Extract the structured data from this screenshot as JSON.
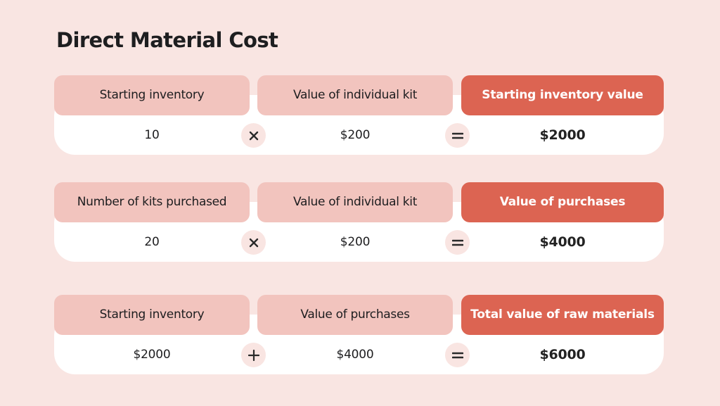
{
  "title": "Direct Material Cost",
  "colors": {
    "background": "#f9e5e2",
    "header_light": "#f2c4be",
    "header_accent": "#dc6452",
    "row": "#ffffff",
    "text": "#1d1d1f"
  },
  "equations": [
    {
      "operand_a": {
        "label": "Starting inventory",
        "value": "10"
      },
      "operator_1": {
        "icon": "multiply-icon",
        "symbol": "×"
      },
      "operand_b": {
        "label": "Value of individual kit",
        "value": "$200"
      },
      "operator_2": {
        "icon": "equals-icon",
        "symbol": "="
      },
      "result": {
        "label": "Starting inventory value",
        "value": "$2000"
      }
    },
    {
      "operand_a": {
        "label": "Number of kits purchased",
        "value": "20"
      },
      "operator_1": {
        "icon": "multiply-icon",
        "symbol": "×"
      },
      "operand_b": {
        "label": "Value of individual kit",
        "value": "$200"
      },
      "operator_2": {
        "icon": "equals-icon",
        "symbol": "="
      },
      "result": {
        "label": "Value of purchases",
        "value": "$4000"
      }
    },
    {
      "operand_a": {
        "label": "Starting inventory",
        "value": "$2000"
      },
      "operator_1": {
        "icon": "plus-icon",
        "symbol": "+"
      },
      "operand_b": {
        "label": "Value of purchases",
        "value": "$4000"
      },
      "operator_2": {
        "icon": "equals-icon",
        "symbol": "="
      },
      "result": {
        "label": "Total value of raw materials",
        "value": "$6000"
      }
    }
  ]
}
